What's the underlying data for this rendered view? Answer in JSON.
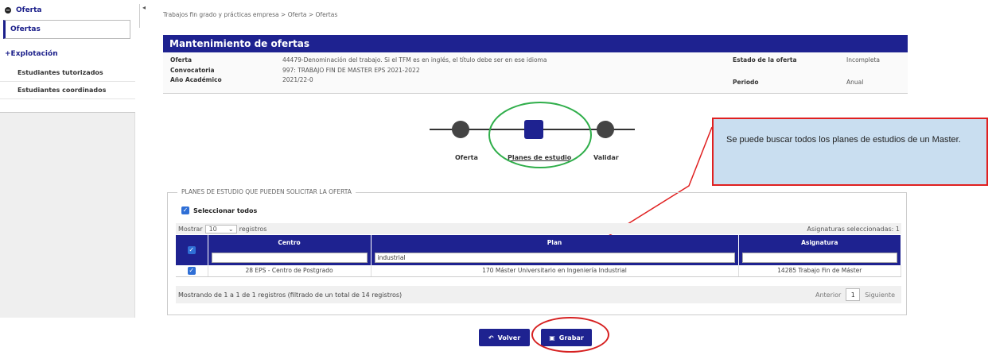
{
  "sidebar": {
    "oferta_header": "Oferta",
    "ofertas_item": "Ofertas",
    "explotacion_header": "Explotación",
    "items": [
      "Estudiantes tutorizados",
      "Estudiantes coordinados"
    ]
  },
  "breadcrumb": "Trabajos fin grado y prácticas empresa > Oferta > Ofertas",
  "panel": {
    "title": "Mantenimiento de ofertas",
    "oferta_label": "Oferta",
    "oferta_value": "44479-Denominación del trabajo. Si el TFM es en inglés, el título debe ser en ese idioma",
    "convocatoria_label": "Convocatoria",
    "convocatoria_value": "997: TRABAJO FIN DE MASTER EPS 2021-2022",
    "anio_label": "Año Académico",
    "anio_value": "2021/22-0",
    "estado_label": "Estado de la oferta",
    "estado_value": "Incompleta",
    "periodo_label": "Periodo",
    "periodo_value": "Anual"
  },
  "steps": {
    "s1": "Oferta",
    "s2": "Planes de estudio",
    "s3": "Validar"
  },
  "callout": "Se puede buscar todos los planes de estudios de un Master.",
  "planes": {
    "legend": "PLANES DE ESTUDIO QUE PUEDEN SOLICITAR LA OFERTA",
    "select_all": "Seleccionar todos",
    "mostrar": "Mostrar",
    "page_size": "10",
    "registros": "registros",
    "selected_count": "Asignaturas seleccionadas: 1",
    "columns": [
      "Centro",
      "Plan",
      "Asignatura"
    ],
    "filters": {
      "centro": "",
      "plan": "industrial",
      "asignatura": ""
    },
    "row": {
      "centro": "28 EPS - Centro de Postgrado",
      "plan": "170 Máster Universitario en Ingeniería Industrial",
      "asignatura": "14285 Trabajo Fin de Máster"
    },
    "footer_info": "Mostrando de 1 a 1 de 1 registros (filtrado de un total de 14 registros)",
    "prev": "Anterior",
    "page": "1",
    "next": "Siguiente"
  },
  "buttons": {
    "volver": "Volver",
    "grabar": "Grabar"
  },
  "colors": {
    "primary": "#1e2290",
    "annotation_green": "#2fae4a",
    "annotation_red": "#d62020",
    "callout_bg": "#c9def0"
  }
}
